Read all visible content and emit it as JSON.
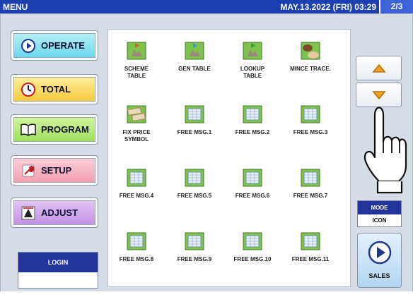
{
  "header": {
    "title": "MENU",
    "datetime": "MAY.13.2022 (FRI)  03:29",
    "page_indicator": "2/3"
  },
  "colors": {
    "header_bg": "#1e3fb0",
    "page_indicator_bg": "#3d63d8",
    "frame_bg": "#d7dde6",
    "label_bar": "#22349a"
  },
  "sidebar": {
    "items": [
      {
        "label": "OPERATE",
        "icon": "play-circle-icon"
      },
      {
        "label": "TOTAL",
        "icon": "clock-icon"
      },
      {
        "label": "PROGRAM",
        "icon": "book-icon"
      },
      {
        "label": "SETUP",
        "icon": "wrench-icon"
      },
      {
        "label": "ADJUST",
        "icon": "adjust-icon"
      }
    ]
  },
  "login": {
    "label": "LOGIN",
    "value": ""
  },
  "grid": {
    "items": [
      {
        "label": "SCHEME\nTABLE",
        "icon": "scheme-table-icon"
      },
      {
        "label": "GEN TABLE",
        "icon": "gen-table-icon"
      },
      {
        "label": "LOOKUP\nTABLE",
        "icon": "lookup-table-icon"
      },
      {
        "label": "MINCE TRACE.",
        "icon": "mince-trace-icon"
      },
      {
        "label": "FIX PRICE\nSYMBOL",
        "icon": "fix-price-symbol-icon"
      },
      {
        "label": "FREE MSG.1",
        "icon": "free-msg-icon"
      },
      {
        "label": "FREE MSG.2",
        "icon": "free-msg-icon"
      },
      {
        "label": "FREE MSG.3",
        "icon": "free-msg-icon"
      },
      {
        "label": "FREE MSG.4",
        "icon": "free-msg-icon"
      },
      {
        "label": "FREE MSG.5",
        "icon": "free-msg-icon"
      },
      {
        "label": "FREE MSG.6",
        "icon": "free-msg-icon"
      },
      {
        "label": "FREE MSG.7",
        "icon": "free-msg-icon"
      },
      {
        "label": "FREE MSG.8",
        "icon": "free-msg-icon"
      },
      {
        "label": "FREE MSG.9",
        "icon": "free-msg-icon"
      },
      {
        "label": "FREE MSG.10",
        "icon": "free-msg-icon"
      },
      {
        "label": "FREE MSG.11",
        "icon": "free-msg-icon"
      }
    ]
  },
  "nav": {
    "up_icon": "triangle-up-icon",
    "down_icon": "triangle-down-icon"
  },
  "mode": {
    "label": "MODE",
    "value": "ICON"
  },
  "sales": {
    "label": "SALES",
    "icon": "sales-play-icon"
  }
}
